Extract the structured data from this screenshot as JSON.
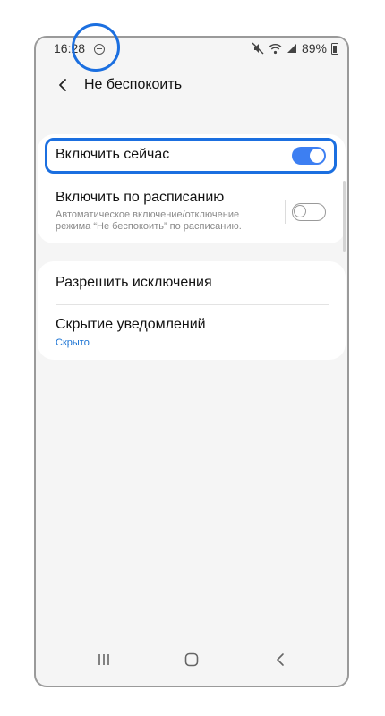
{
  "status_bar": {
    "time": "16:28",
    "battery": "89%"
  },
  "header": {
    "title": "Не беспокоить"
  },
  "settings": {
    "enable_now": {
      "label": "Включить сейчас",
      "state": "on"
    },
    "schedule": {
      "label": "Включить по расписанию",
      "description_line1": "Автоматическое включение/отключение",
      "description_line2": "режима “Не беспокоить” по расписанию.",
      "state": "off"
    },
    "exceptions": {
      "label": "Разрешить исключения"
    },
    "hide_notifications": {
      "label": "Скрытие уведомлений",
      "value": "Скрыто"
    }
  },
  "colors": {
    "accent": "#3d7ff2",
    "annotation": "#1b6fe0",
    "value_text": "#1a73d4",
    "background": "#f5f5f5"
  }
}
